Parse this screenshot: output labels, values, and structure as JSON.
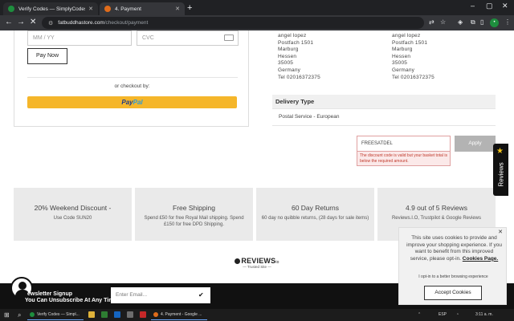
{
  "browser": {
    "tabs": [
      {
        "title": "Verify Codes — SimplyCodes",
        "favicon_color": "#1e8e3e"
      },
      {
        "title": "4. Payment",
        "favicon_color": "#e06c1b"
      }
    ],
    "url_host": "fatbuddhastore.com",
    "url_path": "/checkout/payment"
  },
  "payment": {
    "expiry_placeholder": "MM / YY",
    "cvc_placeholder": "CVC",
    "pay_now_label": "Pay Now",
    "or_checkout_label": "or checkout by:",
    "paypal_pay": "Pay",
    "paypal_pal": "Pal"
  },
  "billing_address": {
    "lines": [
      "angel lopez",
      "Postfach 1501",
      "Marburg",
      "Hessen",
      "35005",
      "Germany",
      "Tel 02016372375"
    ]
  },
  "shipping_address": {
    "lines": [
      "angel lopez",
      "Postfach 1501",
      "Marburg",
      "Hessen",
      "35005",
      "Germany",
      "Tel 02016372375"
    ]
  },
  "delivery": {
    "heading": "Delivery Type",
    "value": "Postal Service - European"
  },
  "discount": {
    "code": "FREESATDEL",
    "error": "The discount code is valid but your basket total is below the required amount.",
    "apply_label": "Apply"
  },
  "features": [
    {
      "title": "20% Weekend Discount -",
      "subtitle": "Use Code SUN20"
    },
    {
      "title": "Free Shipping",
      "subtitle": "Spend £50 for free Royal Mail shipping. Spend £150 for free DPD Shipping."
    },
    {
      "title": "60 Day Returns",
      "subtitle": "60 day no quibble returns, (28 days for sale items)"
    },
    {
      "title": "4.9 out of 5 Reviews",
      "subtitle": "Reviews.I.O, Trustpilot & Google Reviews"
    }
  ],
  "reviews_badge": {
    "logo": "REVIEWS",
    "logo_suffix": "io",
    "tagline": "— Trusted Site —"
  },
  "newsletter": {
    "title": "ewsletter Signup",
    "subtitle": "You Can Unsubscribe At Any Time",
    "email_placeholder": "Enter Email..."
  },
  "reviews_tab": {
    "label": "Reviews"
  },
  "cookie_banner": {
    "text": "This site uses cookies to provide and improve your shopping experience. If you want to benefit from this improved service, please opt-in.",
    "link": "Cookies Page.",
    "optin": "I opt-in to a better browsing experience",
    "accept_label": "Accept Cookies"
  },
  "taskbar": {
    "apps": [
      {
        "label": "Verify Codes — Simpl...",
        "color": "#1e8e3e"
      },
      {
        "label": "4. Payment - Google ...",
        "color": "#e06c1b"
      }
    ],
    "language": "ESP",
    "time": "3:11 a. m."
  }
}
